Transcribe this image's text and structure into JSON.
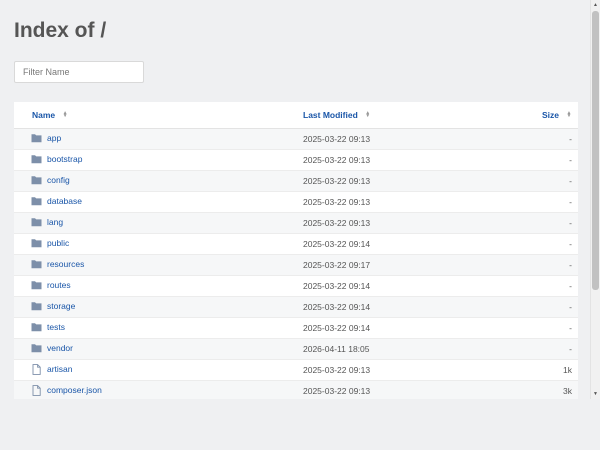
{
  "page": {
    "title": "Index of /",
    "filter_placeholder": "Filter Name"
  },
  "table": {
    "headers": {
      "name": "Name",
      "modified": "Last Modified",
      "size": "Size"
    },
    "rows": [
      {
        "name": "app",
        "type": "folder",
        "modified": "2025-03-22 09:13",
        "size": "-"
      },
      {
        "name": "bootstrap",
        "type": "folder",
        "modified": "2025-03-22 09:13",
        "size": "-"
      },
      {
        "name": "config",
        "type": "folder",
        "modified": "2025-03-22 09:13",
        "size": "-"
      },
      {
        "name": "database",
        "type": "folder",
        "modified": "2025-03-22 09:13",
        "size": "-"
      },
      {
        "name": "lang",
        "type": "folder",
        "modified": "2025-03-22 09:13",
        "size": "-"
      },
      {
        "name": "public",
        "type": "folder",
        "modified": "2025-03-22 09:14",
        "size": "-"
      },
      {
        "name": "resources",
        "type": "folder",
        "modified": "2025-03-22 09:17",
        "size": "-"
      },
      {
        "name": "routes",
        "type": "folder",
        "modified": "2025-03-22 09:14",
        "size": "-"
      },
      {
        "name": "storage",
        "type": "folder",
        "modified": "2025-03-22 09:14",
        "size": "-"
      },
      {
        "name": "tests",
        "type": "folder",
        "modified": "2025-03-22 09:14",
        "size": "-"
      },
      {
        "name": "vendor",
        "type": "folder",
        "modified": "2026-04-11 18:05",
        "size": "-"
      },
      {
        "name": "artisan",
        "type": "file",
        "modified": "2025-03-22 09:13",
        "size": "1k"
      },
      {
        "name": "composer.json",
        "type": "file",
        "modified": "2025-03-22 09:13",
        "size": "3k"
      }
    ]
  },
  "icons": {
    "folder": "folder-icon",
    "file": "file-icon",
    "sort": "sort-icon"
  },
  "colors": {
    "link": "#1a56a8",
    "folder": "#7d8fa9",
    "background": "#eff0f2"
  }
}
